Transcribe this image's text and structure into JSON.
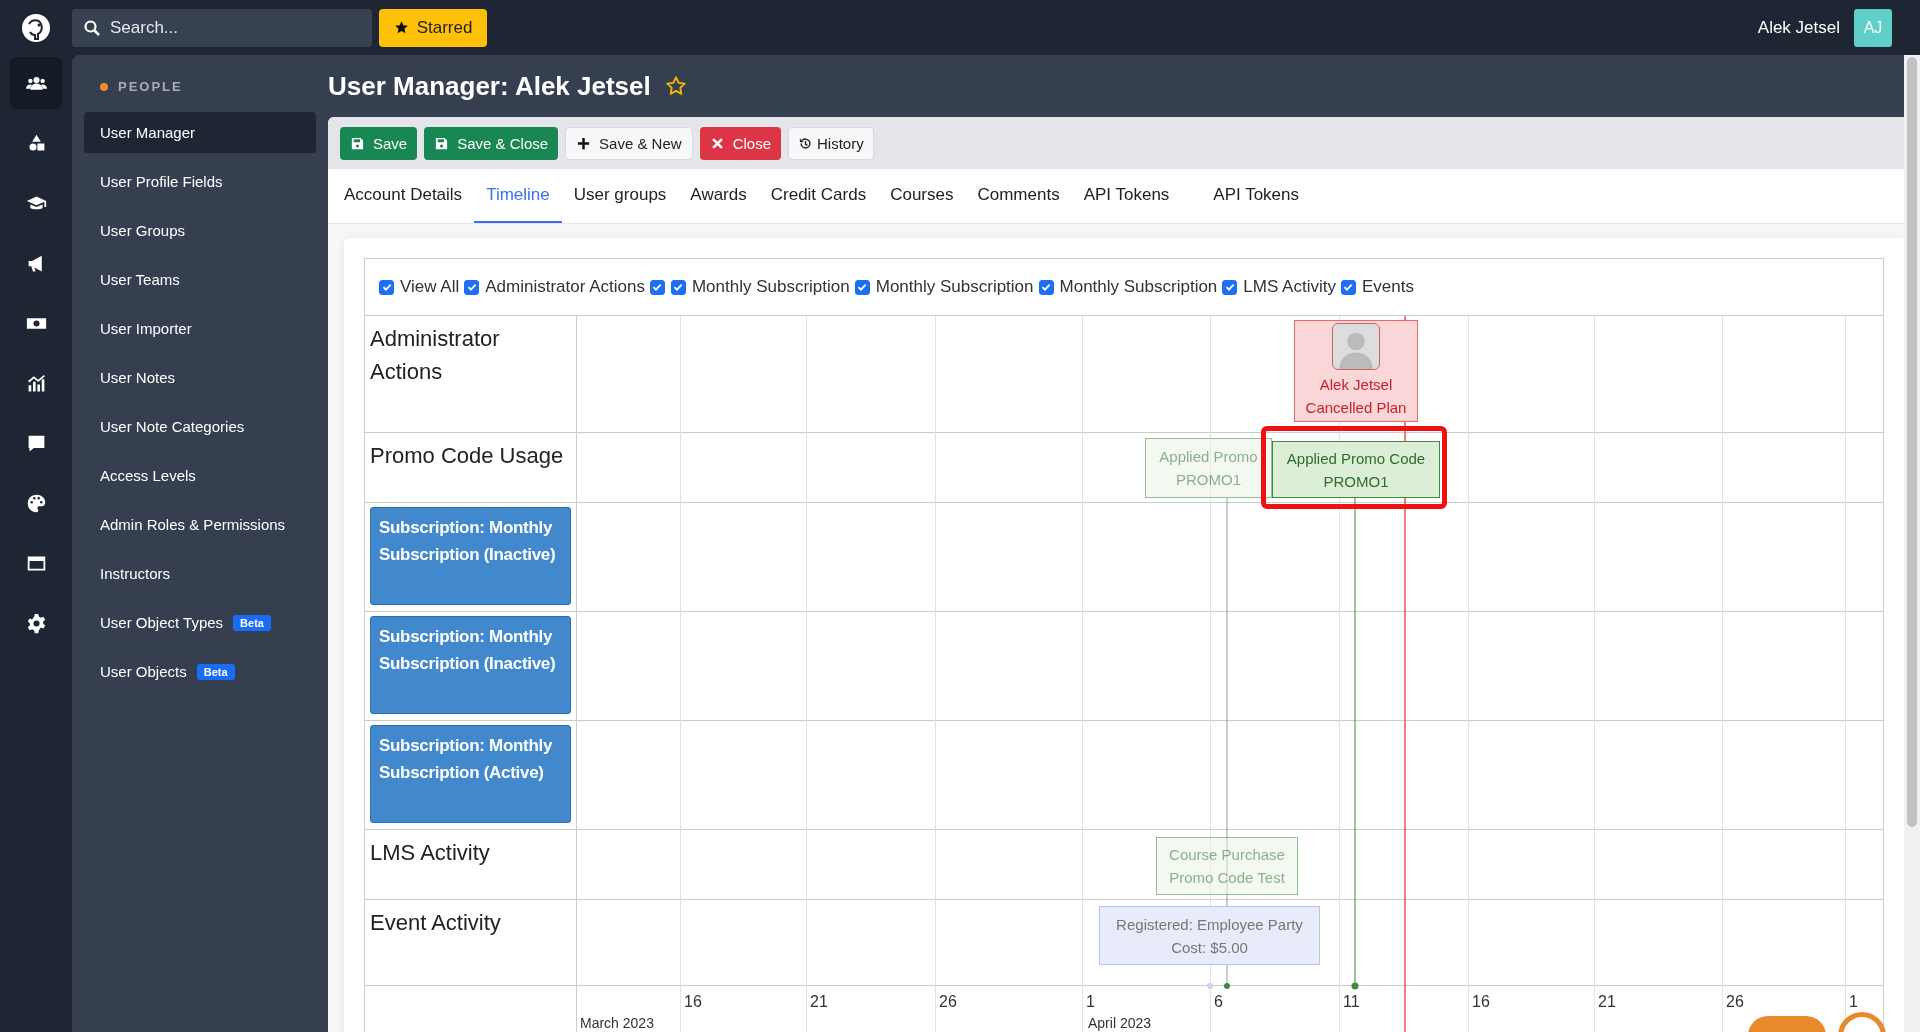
{
  "topbar": {
    "search": {
      "placeholder": "Search..."
    },
    "starred_button": "Starred",
    "user_name": "Alek Jetsel",
    "avatar_initials": "AJ"
  },
  "rail": [
    {
      "selected": true
    },
    {
      "selected": false
    },
    {
      "selected": false
    },
    {
      "selected": false
    },
    {
      "selected": false
    },
    {
      "selected": false
    },
    {
      "selected": false
    },
    {
      "selected": false
    },
    {
      "selected": false
    },
    {
      "selected": false
    }
  ],
  "sidebar": {
    "section": "PEOPLE",
    "items": [
      {
        "label": "User Manager",
        "selected": true
      },
      {
        "label": "User Profile Fields",
        "selected": false
      },
      {
        "label": "User Groups",
        "selected": false
      },
      {
        "label": "User Teams",
        "selected": false
      },
      {
        "label": "User Importer",
        "selected": false
      },
      {
        "label": "User Notes",
        "selected": false
      },
      {
        "label": "User Note Categories",
        "selected": false
      },
      {
        "label": "Access Levels",
        "selected": false
      },
      {
        "label": "Admin Roles & Permissions",
        "selected": false
      },
      {
        "label": "Instructors",
        "selected": false
      },
      {
        "label": "User Object Types",
        "selected": false,
        "badge": "Beta"
      },
      {
        "label": "User Objects",
        "selected": false,
        "badge": "Beta"
      }
    ]
  },
  "page": {
    "title": "User Manager: Alek Jetsel",
    "starred": false
  },
  "toolbar": [
    {
      "label": "Save",
      "kind": "save"
    },
    {
      "label": "Save & Close",
      "kind": "save"
    },
    {
      "label": "Save & New",
      "kind": "new"
    },
    {
      "label": "Close",
      "kind": "close"
    },
    {
      "label": "History",
      "kind": "history"
    }
  ],
  "tabs": [
    {
      "label": "Account Details",
      "selected": false
    },
    {
      "label": "Timeline",
      "selected": true
    },
    {
      "label": "User groups",
      "selected": false
    },
    {
      "label": "Awards",
      "selected": false
    },
    {
      "label": "Credit Cards",
      "selected": false
    },
    {
      "label": "Courses",
      "selected": false
    },
    {
      "label": "Comments",
      "selected": false
    },
    {
      "label": "API Tokens",
      "selected": false
    },
    {
      "label": "API Tokens",
      "selected": false
    }
  ],
  "timeline": {
    "filters": [
      {
        "label": "View All",
        "checked": true
      },
      {
        "label": "Administrator Actions",
        "checked": true
      },
      {
        "checked": true
      },
      {
        "label": "Monthly Subscription",
        "checked": true
      },
      {
        "label": "Monthly Subscription",
        "checked": true
      },
      {
        "label": "Monthly Subscription",
        "checked": true
      },
      {
        "label": "LMS Activity",
        "checked": true
      },
      {
        "label": "Events",
        "checked": true
      }
    ],
    "rows": [
      {
        "label": "Administrator Actions",
        "kind": "group",
        "events": [
          {
            "kind": "admin",
            "title": "Alek Jetsel",
            "subtitle": "Cancelled Plan",
            "faded": false,
            "highlighted": false
          }
        ]
      },
      {
        "label": "Promo Code Usage",
        "kind": "group",
        "events": [
          {
            "kind": "promo",
            "title": "Applied Promo",
            "subtitle": "PROMO1",
            "faded": true,
            "highlighted": false
          },
          {
            "kind": "promo",
            "title": "Applied Promo Code",
            "subtitle": "PROMO1",
            "faded": false,
            "highlighted": true
          }
        ]
      },
      {
        "label": "Subscription: Monthly Subscription (Inactive)",
        "kind": "subscription"
      },
      {
        "label": "Subscription: Monthly Subscription (Inactive)",
        "kind": "subscription"
      },
      {
        "label": "Subscription: Monthly Subscription (Active)",
        "kind": "subscription"
      },
      {
        "label": "LMS Activity",
        "kind": "group",
        "events": [
          {
            "kind": "promo",
            "title": "Course Purchase",
            "subtitle": "Promo Code Test",
            "faded": true,
            "highlighted": false
          }
        ]
      },
      {
        "label": "Event Activity",
        "kind": "group",
        "events": [
          {
            "kind": "event",
            "title": "Registered: Employee Party",
            "subtitle": "Cost: $5.00",
            "faded": false,
            "highlighted": false
          }
        ]
      }
    ],
    "ticks": [
      "16",
      "21",
      "26",
      "1",
      "6",
      "11",
      "16",
      "21",
      "26",
      "1"
    ],
    "months": [
      "March 2023",
      "April 2023"
    ]
  }
}
